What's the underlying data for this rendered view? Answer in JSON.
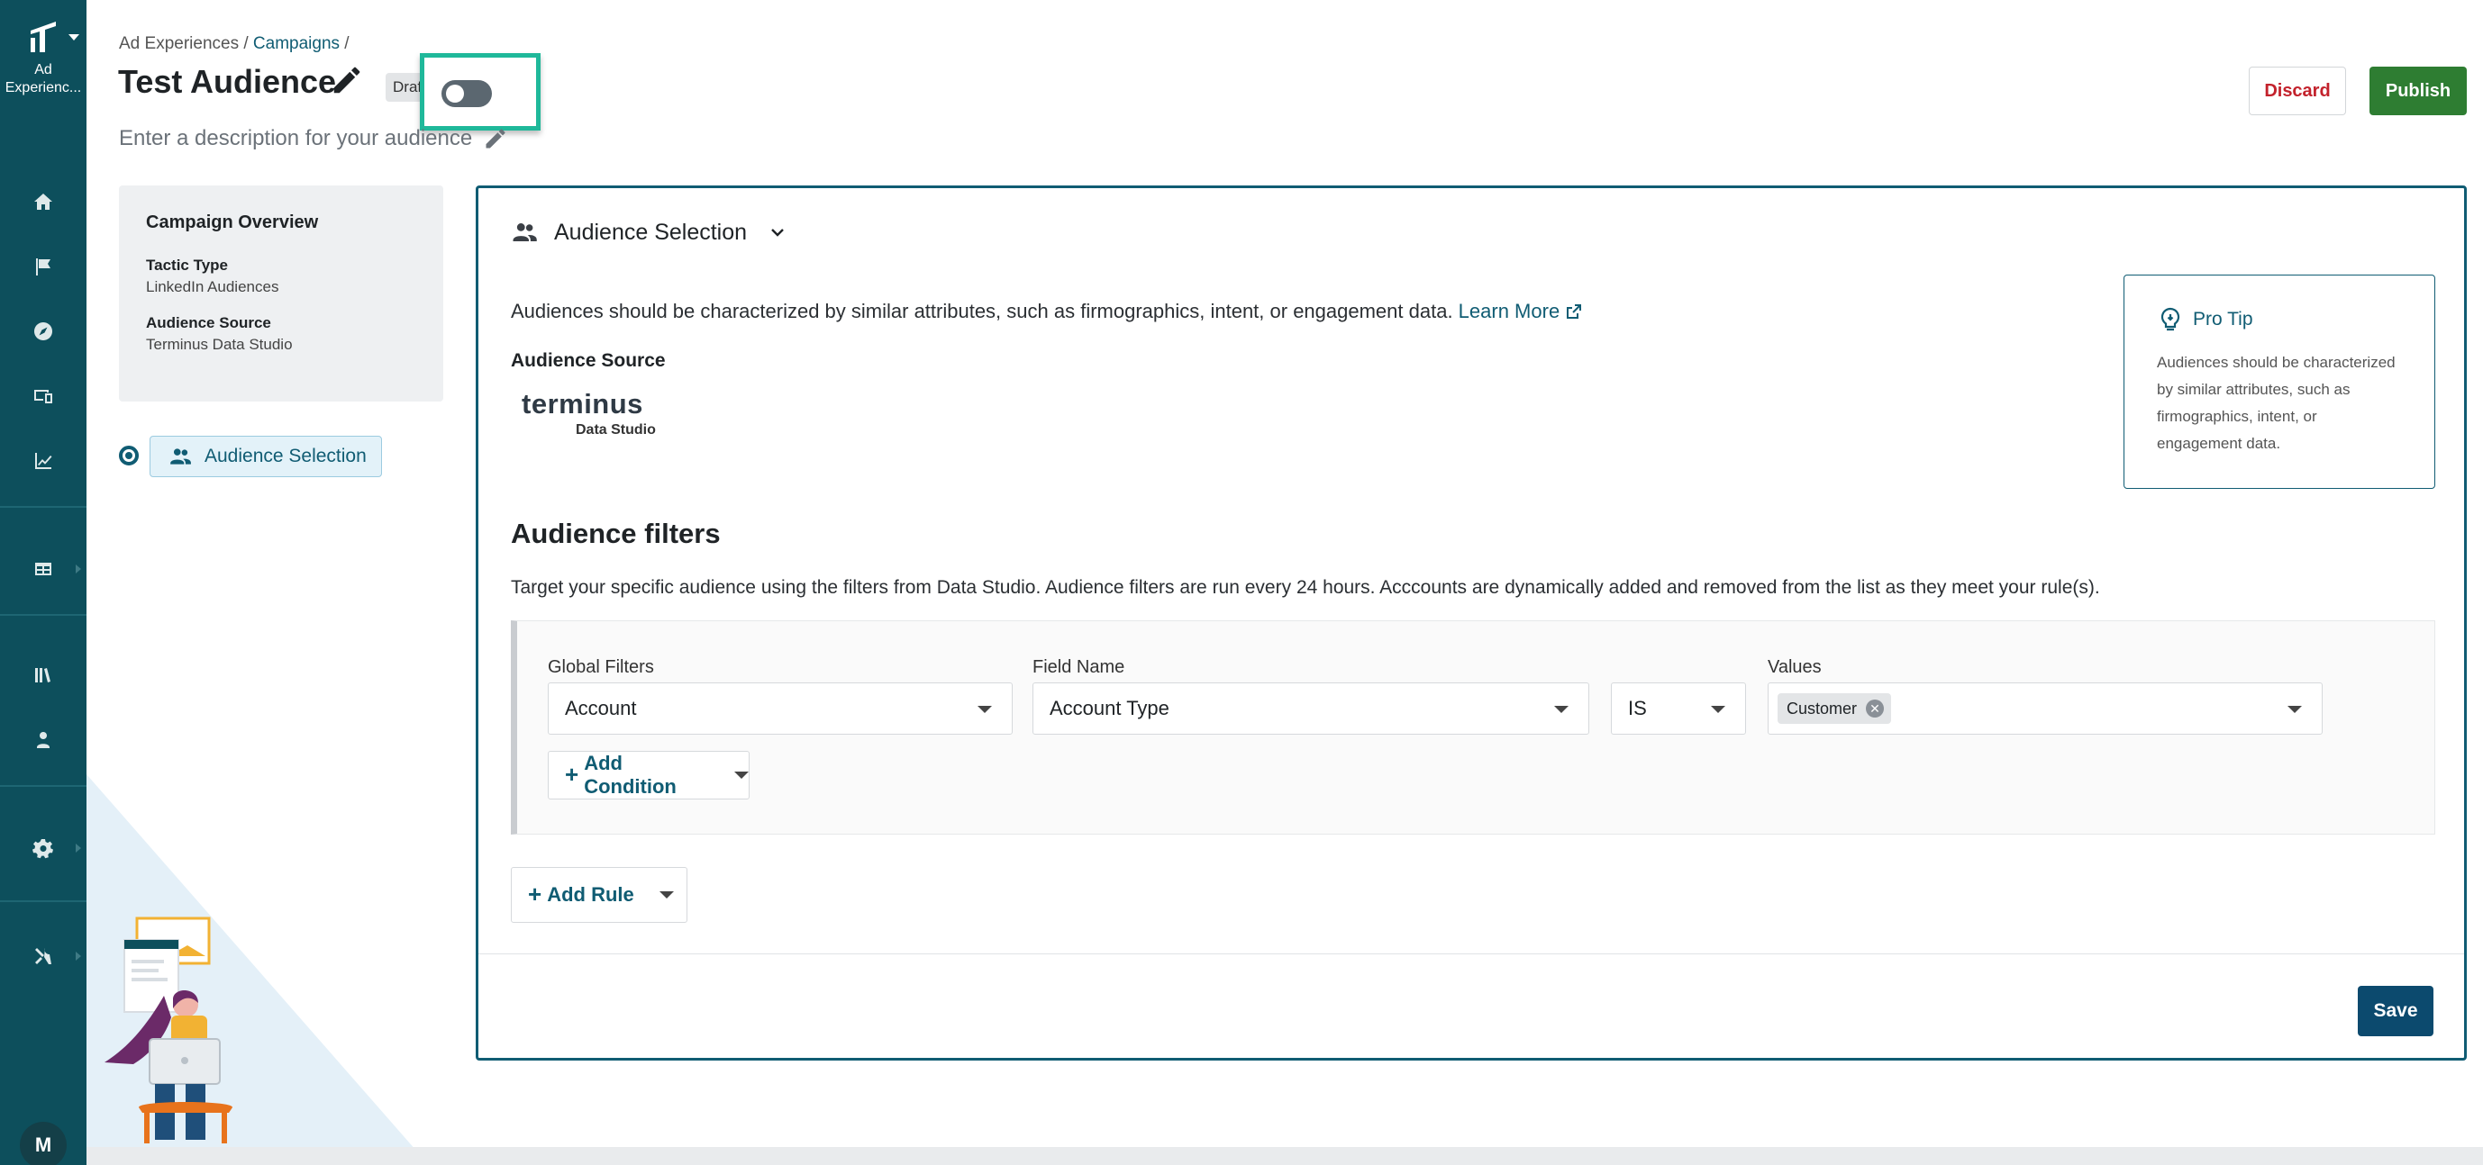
{
  "rail": {
    "brand_label": "Ad\nExperienc...",
    "avatar_initial": "M",
    "items": [
      {
        "icon": "home-icon"
      },
      {
        "icon": "flag-icon"
      },
      {
        "icon": "compass-icon"
      },
      {
        "icon": "devices-icon"
      },
      {
        "icon": "chart-line-icon"
      },
      {
        "icon": "table-icon"
      },
      {
        "icon": "library-icon"
      },
      {
        "icon": "user-badge-icon"
      },
      {
        "icon": "gear-icon"
      },
      {
        "icon": "tools-icon"
      }
    ]
  },
  "header": {
    "breadcrumb_root": "Ad Experiences",
    "breadcrumb_sep": " / ",
    "breadcrumb_campaigns": "Campaigns",
    "breadcrumb_tail": " /",
    "title": "Test Audience",
    "status_badge": "Draft",
    "description_placeholder": "Enter a description for your audience",
    "discard_label": "Discard",
    "publish_label": "Publish"
  },
  "overview": {
    "heading": "Campaign Overview",
    "tactic_label": "Tactic Type",
    "tactic_value": "LinkedIn Audiences",
    "source_label": "Audience Source",
    "source_value": "Terminus Data Studio"
  },
  "steps": {
    "current_label": "Audience Selection"
  },
  "card": {
    "section_title": "Audience Selection",
    "intro_text": "Audiences should be characterized by similar attributes, such as firmographics, intent, or engagement data. ",
    "learn_more": "Learn More",
    "source_label": "Audience Source",
    "logo_word": "terminus",
    "logo_sub": "Data Studio",
    "pro_tip": {
      "title": "Pro Tip",
      "body": "Audiences should be characterized by similar attributes, such as firmographics, intent, or engagement data."
    },
    "filters_title": "Audience filters",
    "filters_desc": "Target your specific audience using the filters from Data Studio. Audience filters are run every 24 hours. Acccounts are dynamically added and removed from the list as they meet your rule(s).",
    "rule": {
      "global_filters_label": "Global Filters",
      "global_filters_value": "Account",
      "field_name_label": "Field Name",
      "field_name_value": "Account Type",
      "operator_value": "IS",
      "values_label": "Values",
      "values_chips": [
        "Customer"
      ],
      "add_condition_label": "Add Condition"
    },
    "add_rule_label": "Add Rule",
    "save_label": "Save"
  },
  "colors": {
    "rail": "#0d4f5c",
    "accent": "#105c73",
    "publish": "#2e7d32",
    "discard_text": "#c3222c",
    "save": "#0c4a6e",
    "highlight": "#1fb89a"
  }
}
